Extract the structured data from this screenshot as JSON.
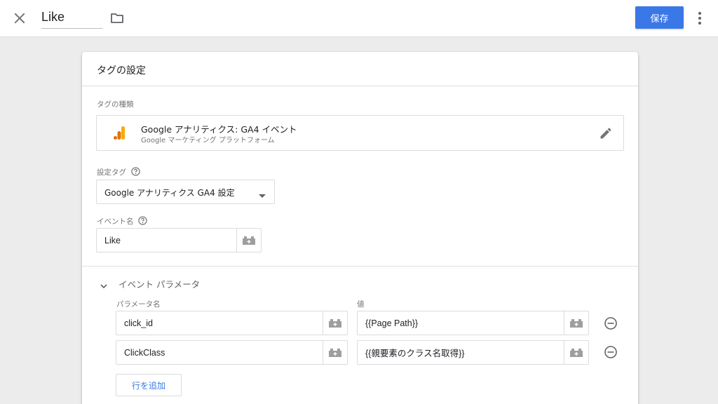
{
  "topbar": {
    "close_icon": "close-icon",
    "title_value": "Like",
    "folder_icon": "folder-icon",
    "save_label": "保存",
    "more_icon": "more-vert-icon"
  },
  "card": {
    "title": "タグの設定",
    "tag_type": {
      "label": "タグの種類",
      "name": "Google アナリティクス: GA4 イベント",
      "subtitle": "Google マーケティング プラットフォーム",
      "logo_icon": "google-analytics-icon",
      "edit_icon": "edit-pencil-icon"
    },
    "config_tag": {
      "label": "設定タグ",
      "selected": "Google アナリティクス GA4 設定"
    },
    "event_name": {
      "label": "イベント名",
      "value": "Like"
    },
    "event_params": {
      "title": "イベント パラメータ",
      "column_name": "パラメータ名",
      "column_value": "値",
      "rows": [
        {
          "name": "click_id",
          "value": "{{Page Path}}"
        },
        {
          "name": "ClickClass",
          "value": "{{親要素のクラス名取得}}"
        }
      ],
      "add_row_label": "行を追加"
    }
  },
  "colors": {
    "accent": "#3b78e7",
    "background": "#ececec",
    "ga_orange": "#f9ab00",
    "ga_dark_orange": "#e37400"
  }
}
